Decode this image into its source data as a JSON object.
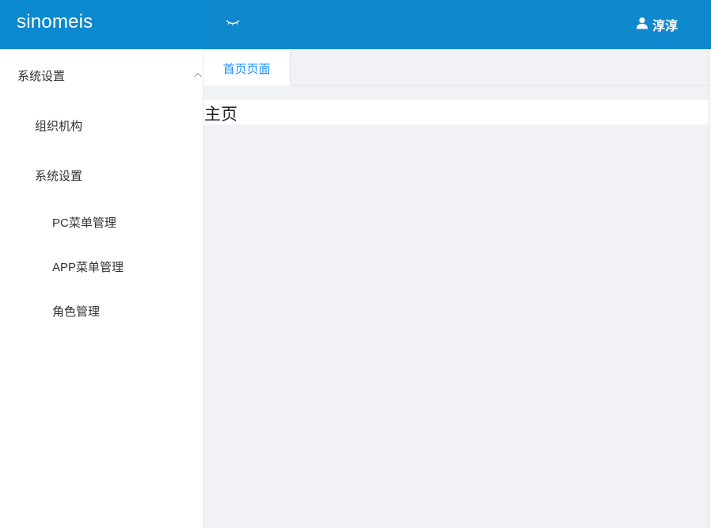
{
  "brand": {
    "name": "sinomeis"
  },
  "header": {
    "user_name": "淳淳",
    "colors": {
      "logo_bg": "#0a89d0",
      "header_bg": "#0f88cd"
    }
  },
  "sidebar": {
    "items": [
      {
        "label": "系统设置",
        "level": 1,
        "expanded": true
      },
      {
        "label": "组织机构",
        "level": 2,
        "expanded": false
      },
      {
        "label": "系统设置",
        "level": 2,
        "expanded": true
      },
      {
        "label": "PC菜单管理",
        "level": 3
      },
      {
        "label": "APP菜单管理",
        "level": 3
      },
      {
        "label": "角色管理",
        "level": 3
      }
    ]
  },
  "tabs": [
    {
      "label": "首页页面",
      "active": true
    }
  ],
  "content": {
    "title": "主页"
  },
  "theme": {
    "accent": "#1890ff"
  }
}
